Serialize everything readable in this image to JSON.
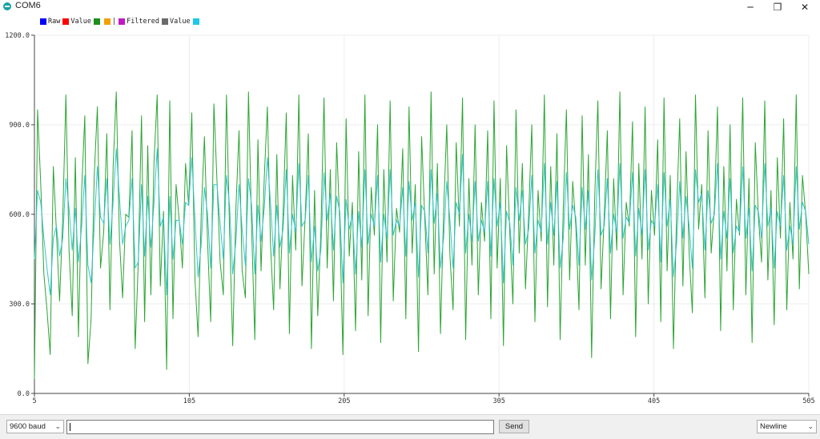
{
  "window": {
    "title": "COM6",
    "minimize_glyph": "─",
    "maximize_glyph": "❐",
    "close_glyph": "✕"
  },
  "legend": [
    {
      "label": "Raw",
      "color": "#0000ff"
    },
    {
      "label": "Value",
      "color": "#ff0000"
    },
    {
      "label": "",
      "color": "#1d8f1d"
    },
    {
      "label": "|",
      "color": "#f5a00a"
    },
    {
      "label": "Filtered",
      "color": "#c21ac2"
    },
    {
      "label": "Value",
      "color": "#6a6a6a"
    },
    {
      "label": "",
      "color": "#1ec8e8"
    }
  ],
  "chart_data": {
    "type": "line",
    "title": "",
    "xlim": [
      5,
      505
    ],
    "ylim": [
      0,
      1200
    ],
    "x_ticks": [
      "5",
      "105",
      "205",
      "305",
      "405",
      "505"
    ],
    "y_ticks": [
      "0.0",
      "300.0",
      "600.0",
      "900.0",
      "1200.0"
    ],
    "grid": true,
    "series": [
      {
        "color": "#2aa532",
        "values": [
          48,
          950,
          700,
          400,
          280,
          130,
          760,
          540,
          310,
          590,
          1000,
          480,
          260,
          790,
          190,
          680,
          930,
          100,
          250,
          730,
          960,
          420,
          540,
          870,
          280,
          760,
          1010,
          520,
          320,
          600,
          590,
          880,
          150,
          440,
          930,
          240,
          830,
          330,
          780,
          1000,
          360,
          610,
          80,
          980,
          250,
          700,
          580,
          420,
          770,
          630,
          940,
          380,
          190,
          600,
          860,
          510,
          240,
          970,
          710,
          440,
          330,
          1000,
          540,
          160,
          620,
          880,
          410,
          320,
          1010,
          560,
          180,
          850,
          410,
          720,
          960,
          500,
          280,
          800,
          350,
          600,
          940,
          200,
          730,
          480,
          1000,
          360,
          590,
          870,
          150,
          680,
          260,
          540,
          990,
          420,
          750,
          310,
          840,
          570,
          130,
          920,
          460,
          640,
          210,
          810,
          380,
          1000,
          260,
          690,
          530,
          900,
          170,
          750,
          440,
          980,
          310,
          620,
          540,
          820,
          250,
          960,
          470,
          700,
          140,
          860,
          590,
          330,
          1010,
          400,
          770,
          200,
          610,
          900,
          460,
          280,
          840,
          560,
          990,
          180,
          720,
          430,
          900,
          330,
          640,
          510,
          880,
          250,
          980,
          420,
          720,
          160,
          830,
          540,
          300,
          950,
          470,
          770,
          350,
          600,
          900,
          240,
          680,
          510,
          1000,
          290,
          760,
          430,
          870,
          180,
          620,
          950,
          380,
          710,
          560,
          280,
          930,
          430,
          800,
          120,
          660,
          980,
          350,
          590,
          880,
          250,
          720,
          480,
          1010,
          330,
          640,
          560,
          910,
          190,
          770,
          450,
          960,
          300,
          680,
          530,
          850,
          240,
          990,
          410,
          730,
          150,
          600,
          920,
          360,
          810,
          470,
          270,
          1000,
          550,
          700,
          320,
          880,
          470,
          620,
          960,
          210,
          760,
          410,
          900,
          280,
          650,
          530,
          990,
          330,
          720,
          170,
          840,
          590,
          440,
          980,
          380,
          680,
          230,
          790,
          520,
          920,
          280,
          640,
          450,
          1000,
          350,
          730,
          600,
          400
        ]
      },
      {
        "color": "#33c4cf",
        "values": [
          450,
          680,
          640,
          520,
          420,
          330,
          520,
          560,
          460,
          520,
          720,
          620,
          480,
          620,
          440,
          560,
          730,
          430,
          370,
          560,
          760,
          590,
          570,
          720,
          500,
          640,
          820,
          660,
          500,
          560,
          580,
          720,
          420,
          440,
          700,
          460,
          660,
          490,
          640,
          820,
          560,
          590,
          330,
          660,
          450,
          580,
          580,
          500,
          640,
          630,
          790,
          580,
          390,
          500,
          690,
          600,
          420,
          700,
          700,
          570,
          450,
          730,
          630,
          400,
          510,
          700,
          550,
          430,
          720,
          630,
          400,
          630,
          510,
          620,
          790,
          640,
          460,
          630,
          490,
          550,
          750,
          470,
          600,
          540,
          770,
          560,
          580,
          730,
          440,
          560,
          410,
          480,
          740,
          580,
          670,
          480,
          660,
          610,
          370,
          650,
          550,
          600,
          400,
          610,
          490,
          750,
          500,
          600,
          560,
          730,
          440,
          600,
          520,
          750,
          530,
          580,
          560,
          690,
          460,
          710,
          580,
          640,
          390,
          630,
          610,
          470,
          750,
          570,
          670,
          420,
          520,
          710,
          580,
          420,
          640,
          600,
          800,
          470,
          600,
          510,
          710,
          510,
          580,
          540,
          710,
          460,
          720,
          560,
          640,
          370,
          610,
          570,
          430,
          690,
          580,
          680,
          500,
          550,
          730,
          470,
          580,
          540,
          770,
          500,
          640,
          530,
          710,
          420,
          520,
          740,
          550,
          630,
          590,
          430,
          690,
          550,
          680,
          380,
          520,
          750,
          530,
          560,
          720,
          470,
          600,
          540,
          770,
          520,
          590,
          570,
          740,
          460,
          620,
          530,
          750,
          480,
          580,
          560,
          700,
          440,
          740,
          560,
          650,
          390,
          500,
          710,
          520,
          660,
          560,
          420,
          750,
          640,
          670,
          480,
          680,
          570,
          600,
          770,
          450,
          610,
          520,
          720,
          470,
          560,
          540,
          760,
          520,
          620,
          410,
          630,
          610,
          520,
          770,
          560,
          620,
          420,
          610,
          560,
          730,
          480,
          560,
          500,
          760,
          550,
          640,
          610,
          500
        ]
      }
    ]
  },
  "bottom": {
    "baud_selected": "9600 baud",
    "message_value": "",
    "send_label": "Send",
    "line_ending_selected": "Newline"
  }
}
